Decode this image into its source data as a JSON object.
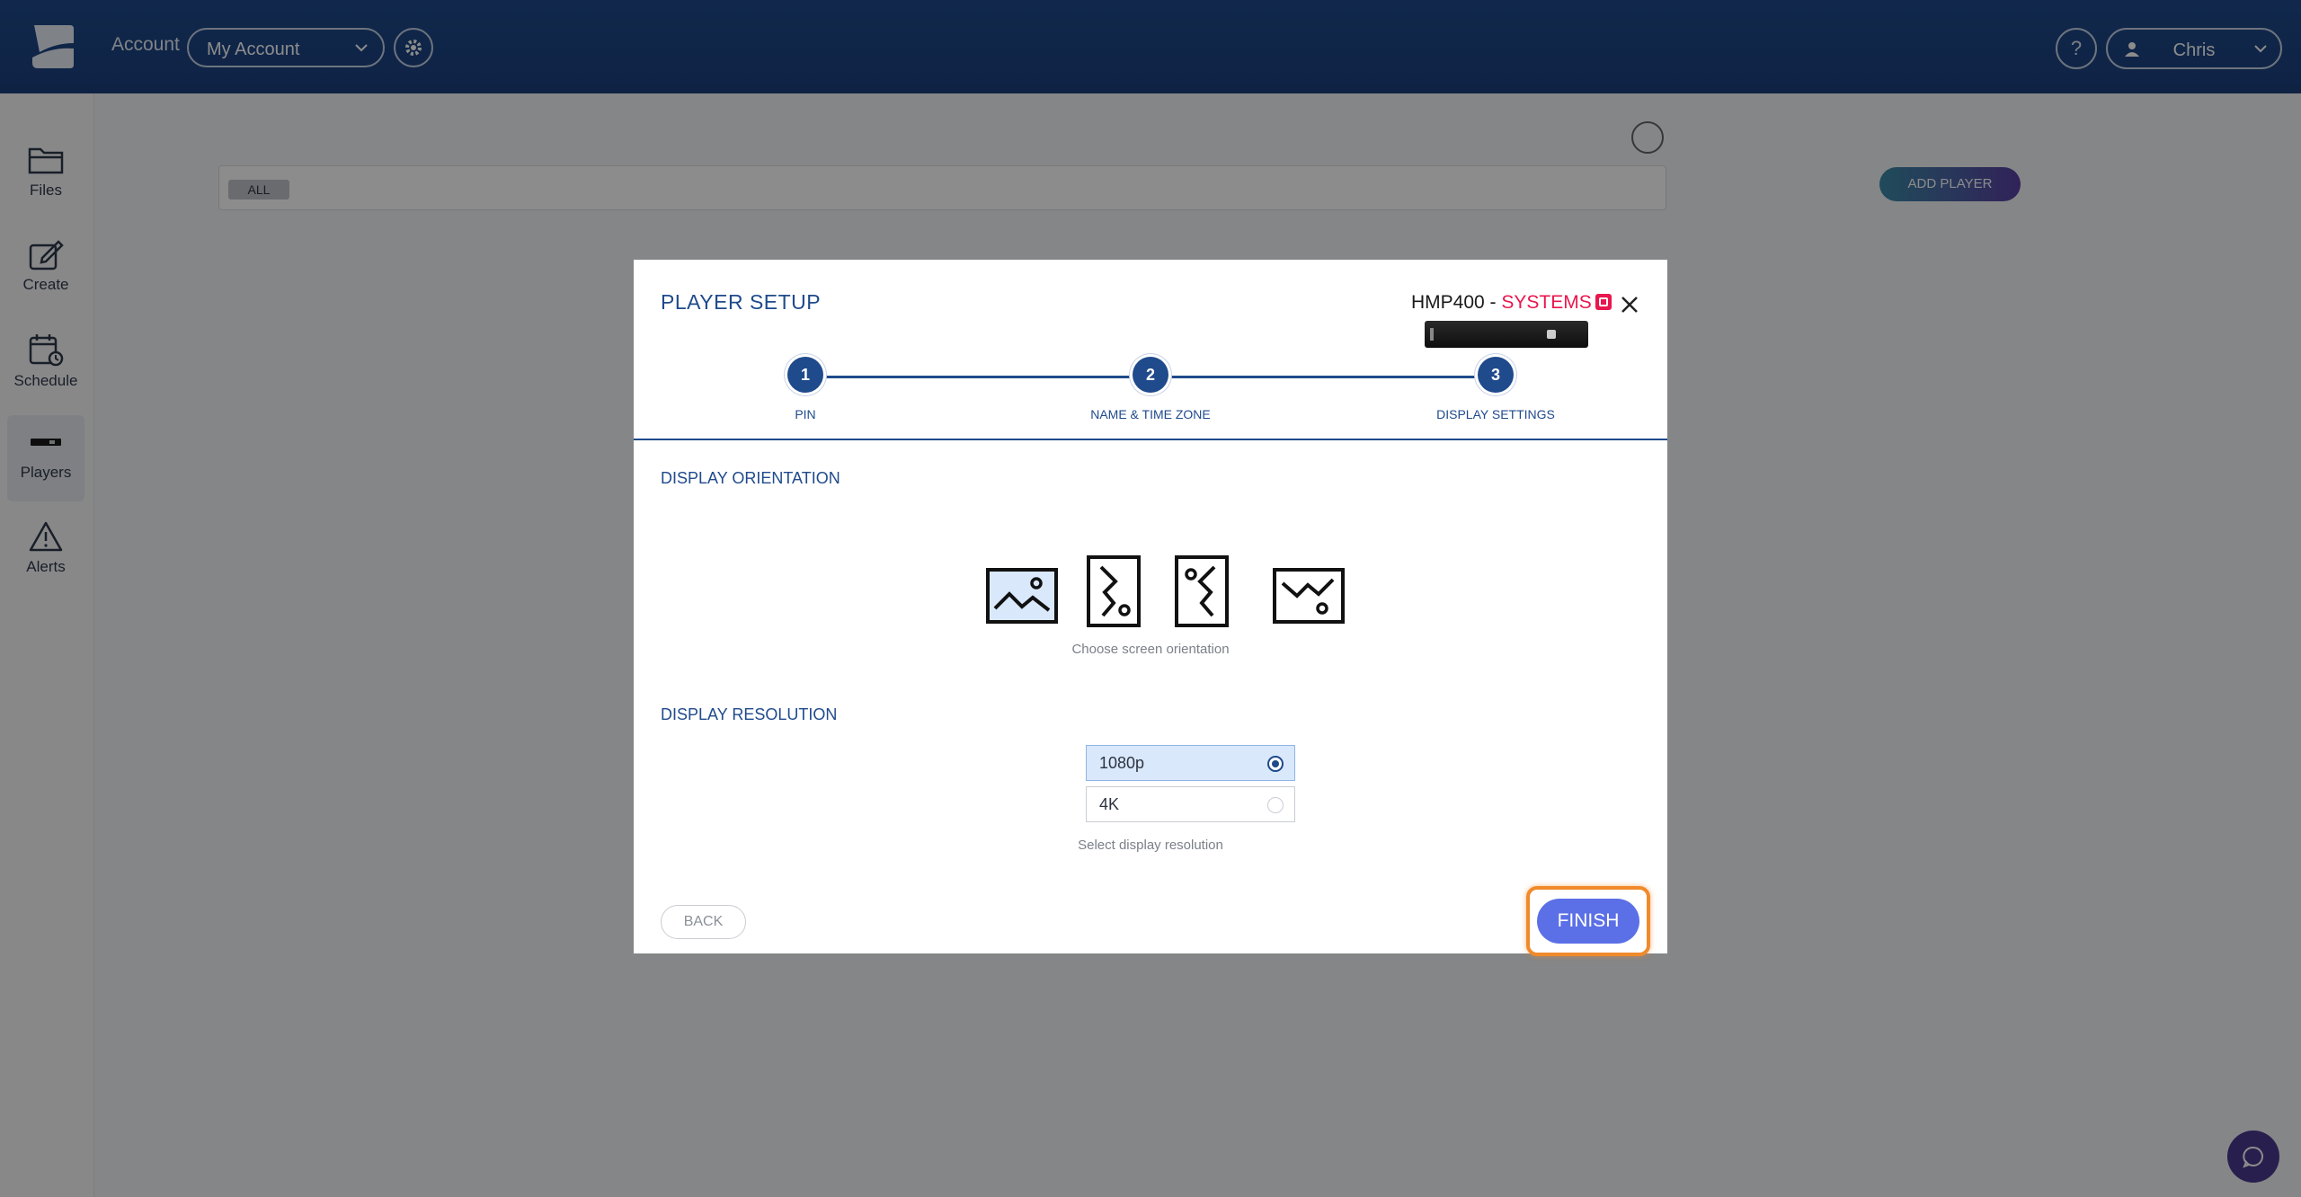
{
  "topbar": {
    "account_label": "Account",
    "account_select": "My Account",
    "help": "?",
    "user": "Chris"
  },
  "sidebar": {
    "items": [
      {
        "label": "Files",
        "icon": "folder-icon"
      },
      {
        "label": "Create",
        "icon": "edit-icon"
      },
      {
        "label": "Schedule",
        "icon": "calendar-icon"
      },
      {
        "label": "Players",
        "icon": "player-icon",
        "active": true
      },
      {
        "label": "Alerts",
        "icon": "alert-icon"
      }
    ]
  },
  "content": {
    "filter_chip": "ALL",
    "add_player": "ADD PLAYER"
  },
  "modal": {
    "title": "PLAYER SETUP",
    "product_model": "HMP400 - ",
    "product_brand": "SYSTEMS",
    "steps": [
      {
        "number": "1",
        "label": "PIN"
      },
      {
        "number": "2",
        "label": "NAME & TIME ZONE"
      },
      {
        "number": "3",
        "label": "DISPLAY SETTINGS"
      }
    ],
    "orientation_title": "DISPLAY ORIENTATION",
    "orientation_hint": "Choose screen orientation",
    "resolution_title": "DISPLAY RESOLUTION",
    "resolution_options": [
      {
        "label": "1080p",
        "selected": true
      },
      {
        "label": "4K",
        "selected": false
      }
    ],
    "resolution_hint": "Select display resolution",
    "back": "BACK",
    "finish": "FINISH"
  },
  "colors": {
    "primary": "#1f4a8c",
    "brand_red": "#e8174d",
    "finish": "#5b6fe6",
    "highlight": "#f08a2b"
  }
}
